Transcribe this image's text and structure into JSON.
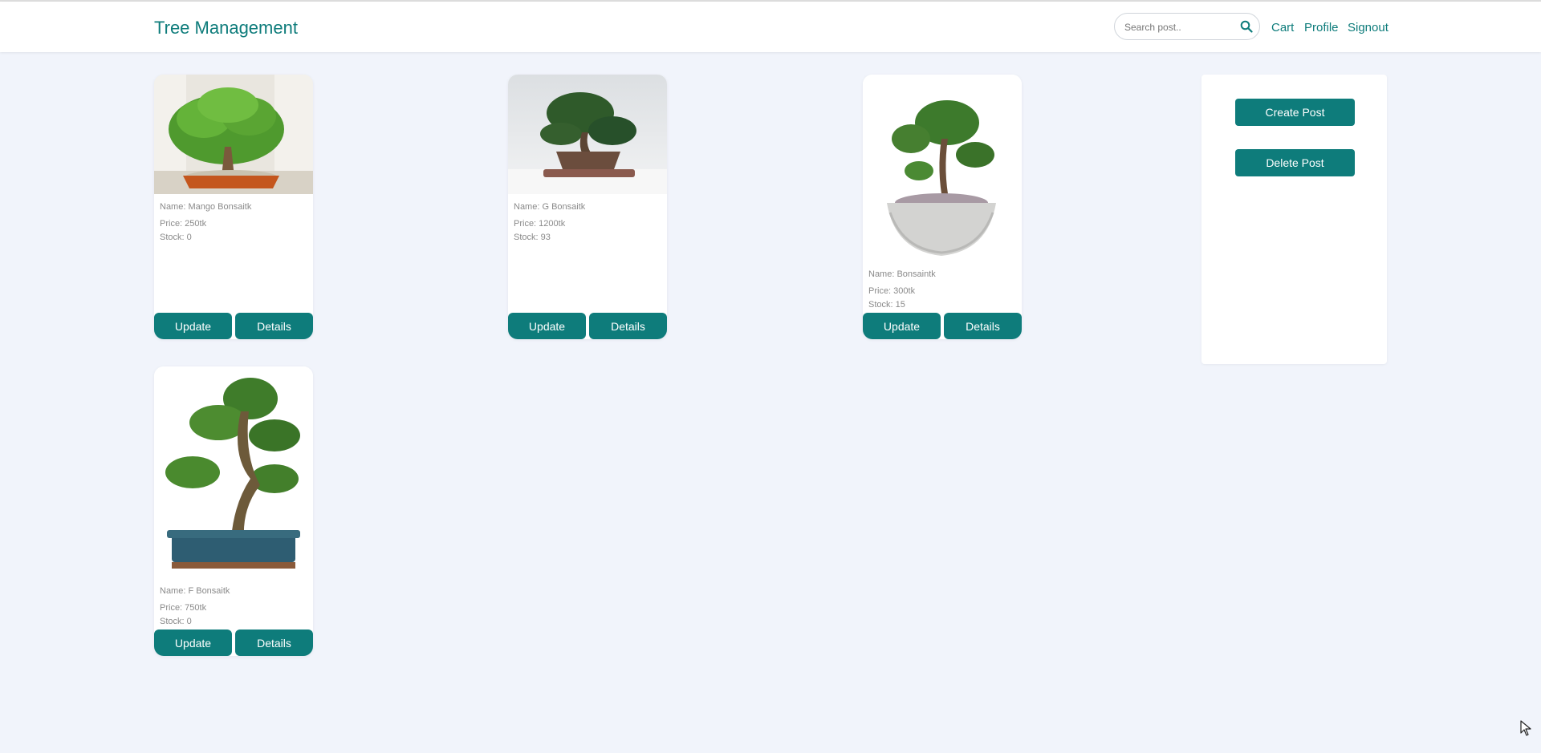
{
  "header": {
    "brand": "Tree Management",
    "search_placeholder": "Search post..",
    "nav": [
      "Cart",
      "Profile",
      "Signout"
    ]
  },
  "products": [
    {
      "name_line": "Name: Mango Bonsaitk",
      "price_line": "Price: 250tk",
      "stock_line": "Stock: 0",
      "update_label": "Update",
      "details_label": "Details"
    },
    {
      "name_line": "Name: G Bonsaitk",
      "price_line": "Price: 1200tk",
      "stock_line": "Stock: 93",
      "update_label": "Update",
      "details_label": "Details"
    },
    {
      "name_line": "Name: Bonsaintk",
      "price_line": "Price: 300tk",
      "stock_line": "Stock: 15",
      "update_label": "Update",
      "details_label": "Details"
    },
    {
      "name_line": "Name: F Bonsaitk",
      "price_line": "Price: 750tk",
      "stock_line": "Stock: 0",
      "update_label": "Update",
      "details_label": "Details"
    }
  ],
  "panel": {
    "create_label": "Create Post",
    "delete_label": "Delete Post"
  },
  "colors": {
    "accent": "#0e7c7b",
    "background": "#f1f4fb",
    "card": "#ffffff"
  }
}
